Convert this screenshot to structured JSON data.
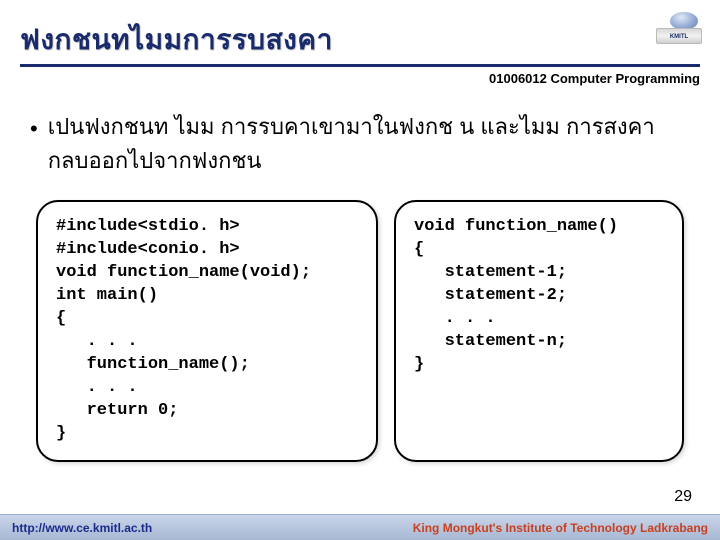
{
  "header": {
    "title": "ฟงกชนทไมมการรบสงคา",
    "course_code": "01006012 Computer Programming",
    "logo_text": "KMITL"
  },
  "bullet": {
    "mark": "•",
    "text": "เปนฟงกชนท          ไมม    การรบคาเขามาในฟงกช น   และไมม    การสงคากลบออกไปจากฟงกชน"
  },
  "code_left": "#include<stdio. h>\n#include<conio. h>\nvoid function_name(void);\nint main()\n{\n   . . .\n   function_name();\n   . . .\n   return 0;\n}",
  "code_right": "void function_name()\n{\n   statement-1;\n   statement-2;\n   . . .\n   statement-n;\n}",
  "page_number": "29",
  "footer": {
    "left": "http://www.ce.kmitl.ac.th",
    "right": "King Mongkut's Institute of Technology Ladkrabang"
  }
}
